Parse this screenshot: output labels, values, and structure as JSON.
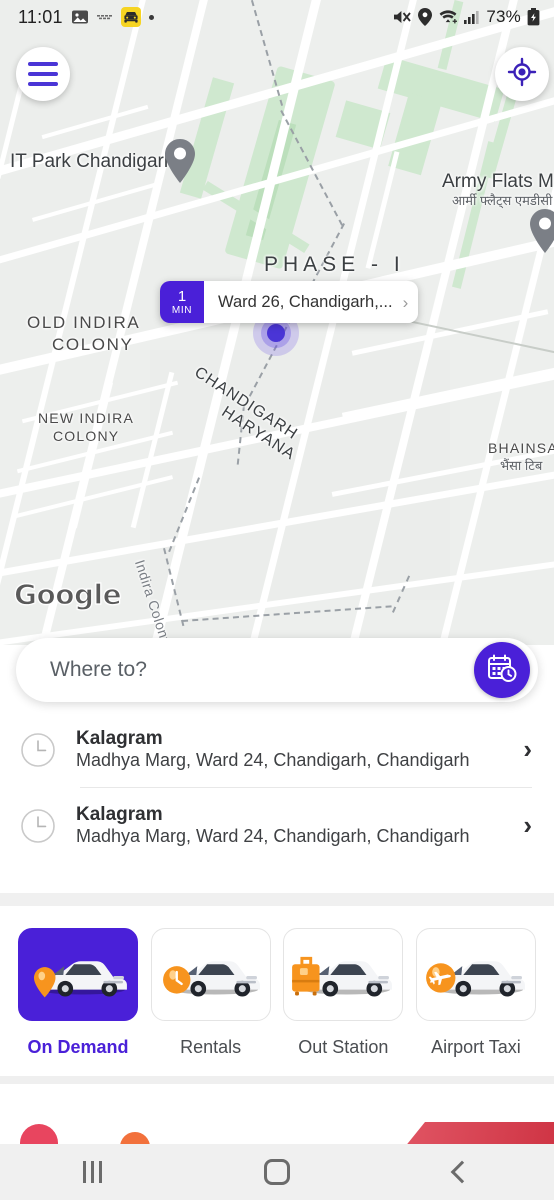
{
  "status_bar": {
    "time": "11:01",
    "left_icons": [
      "image-icon",
      "screenshot-icon",
      "taxi-app-icon",
      "dot-indicator"
    ],
    "right_icons": [
      "mute-icon",
      "location-icon",
      "wifi-icon",
      "signal-icon"
    ],
    "battery_percent": "73%",
    "battery_state": "charging"
  },
  "map": {
    "menu_icon": "hamburger-menu-icon",
    "locate_icon": "my-location-crosshair-icon",
    "watermark": "Google",
    "labels": [
      {
        "text": "IT Park Chandigarh",
        "type": "poi"
      },
      {
        "text": "Army Flats MDC",
        "type": "poi"
      },
      {
        "text": "आर्मी फ्लैट्स एमडीसी",
        "type": "hindi"
      },
      {
        "text": "PHASE - I",
        "type": "area"
      },
      {
        "text": "OLD INDIRA COLONY",
        "type": "neighborhood"
      },
      {
        "text": "NEW INDIRA COLONY",
        "type": "neighborhood"
      },
      {
        "text": "CHANDIGARH",
        "type": "border"
      },
      {
        "text": "HARYANA",
        "type": "border"
      },
      {
        "text": "BHAINSA T",
        "type": "neighborhood"
      },
      {
        "text": "भैंसा टिब",
        "type": "hindi"
      },
      {
        "text": "Indira Colony",
        "type": "street"
      }
    ],
    "old_indira_line1": "OLD INDIRA",
    "old_indira_line2": "COLONY",
    "new_indira_line1": "NEW INDIRA",
    "new_indira_line2": "COLONY",
    "phase_label": "PHASE - I",
    "it_park_label": "IT Park Chandigarh",
    "army_flats_label": "Army Flats MDC",
    "army_flats_hindi": "आर्मी फ्लैट्स एमडीसी",
    "bhainsa_label": "BHAINSA T",
    "bhainsa_hindi": "भैंसा टिब",
    "border_line1": "CHANDIGARH",
    "border_line2": "HARYANA",
    "street_label": "Indira Colony",
    "eta_pill": {
      "minutes": "1",
      "unit": "MIN",
      "address": "Ward 26, Chandigarh,...",
      "chevron": "›"
    }
  },
  "search": {
    "placeholder": "Where to?",
    "schedule_icon": "calendar-clock-icon"
  },
  "recent_places": [
    {
      "icon": "clock-icon",
      "title": "Kalagram",
      "subtitle": "Madhya Marg, Ward 24, Chandigarh, Chandigarh",
      "chevron": "›"
    },
    {
      "icon": "clock-icon",
      "title": "Kalagram",
      "subtitle": "Madhya Marg, Ward 24, Chandigarh, Chandigarh",
      "chevron": "›"
    }
  ],
  "services": [
    {
      "label": "On Demand",
      "icon": "car-with-location-pin-icon",
      "selected": true
    },
    {
      "label": "Rentals",
      "icon": "car-with-clock-icon",
      "selected": false
    },
    {
      "label": "Out Station",
      "icon": "car-with-luggage-icon",
      "selected": false
    },
    {
      "label": "Airport Taxi",
      "icon": "car-with-airplane-icon",
      "selected": false
    }
  ],
  "nav_bar": {
    "recents_label": "recents-icon",
    "home_label": "home-icon",
    "back_label": "back-icon"
  },
  "colors": {
    "accent_purple": "#4a20d8",
    "badge_orange": "#f5941f",
    "map_green": "#cfe8cf",
    "promo_red": "#d93a4a"
  }
}
